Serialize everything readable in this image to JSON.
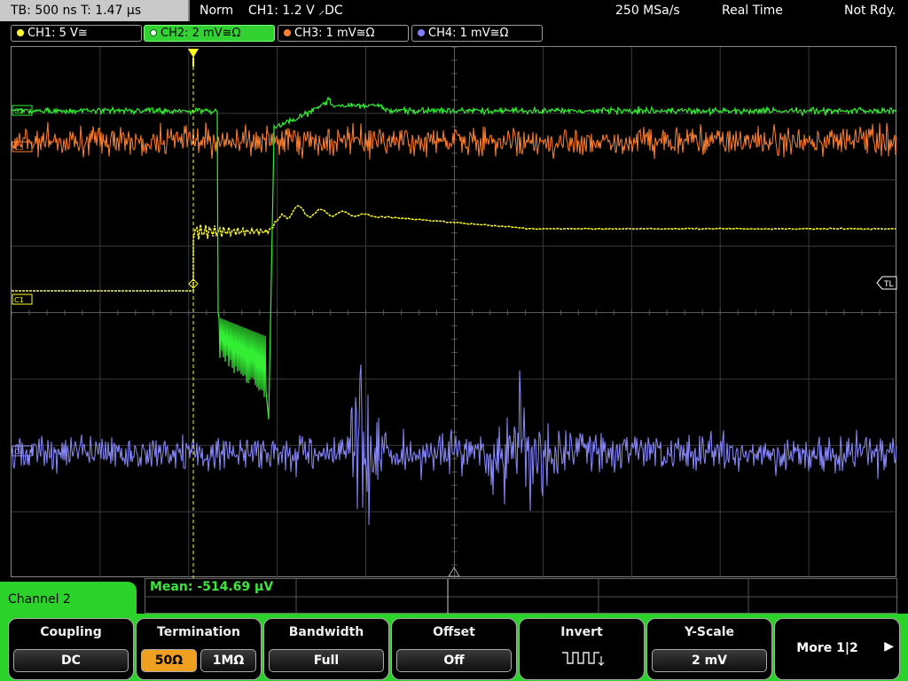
{
  "topbar": {
    "timebase": "TB: 500 ns   T: 1.47 µs",
    "mode": "Norm",
    "trigger": "CH1: 1.2 V ⸝DC",
    "sample_rate": "250 MSa/s",
    "acq": "Real Time",
    "state": "Not Rdy."
  },
  "channels": [
    {
      "label": "CH1: 5 V≅",
      "color": "#ffff33"
    },
    {
      "label": "CH2: 2 mV≅Ω",
      "color": "#33ee33"
    },
    {
      "label": "CH3: 1 mV≅Ω",
      "color": "#ff8030"
    },
    {
      "label": "CH4: 1 mV≅Ω",
      "color": "#8080ff"
    }
  ],
  "markers": {
    "c2": "C2",
    "c3": "C3",
    "c1": "C1",
    "c4": "C4",
    "tl": "TL"
  },
  "measurement": "Mean: -514.69 µV",
  "menu_title": "Channel 2",
  "softkeys": {
    "coupling": {
      "title": "Coupling",
      "value": "DC"
    },
    "termination": {
      "title": "Termination",
      "opt1": "50Ω",
      "opt2": "1MΩ"
    },
    "bandwidth": {
      "title": "Bandwidth",
      "value": "Full"
    },
    "offset": {
      "title": "Offset",
      "value": "Off"
    },
    "invert": {
      "title": "Invert"
    },
    "yscale": {
      "title": "Y-Scale",
      "value": "2 mV"
    },
    "more": {
      "label": "More 1|2"
    }
  }
}
